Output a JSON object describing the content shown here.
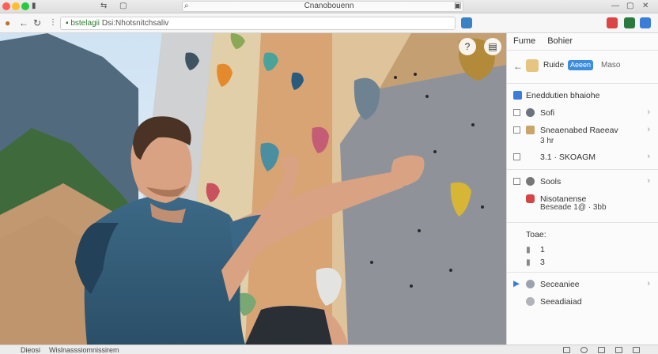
{
  "window": {
    "title": "Cnanobouenn"
  },
  "navbar": {
    "url_host": "bstelagii",
    "url_path": "Dsi:Nhotsnitchsaliv"
  },
  "panel": {
    "tabs": [
      "Fume",
      "Bohier"
    ],
    "top": {
      "label": "Ruide",
      "button": "Aeeen",
      "alt": "Maso"
    },
    "rows": [
      {
        "text": "Eneddutien bhaiohe",
        "icon_color": "#3c7dd9"
      },
      {
        "text": "Sofi",
        "icon_color": "#6b7280"
      },
      {
        "text": "Sneaenabed Raeeav",
        "icon_color": "#c9a56a"
      },
      {
        "text": "3.1 · SKOAGM",
        "icon_color": "#888888"
      },
      {
        "text": "Sools",
        "icon_color": "#777777"
      },
      {
        "text": "Nisotanense",
        "icon_color": "#d64545"
      }
    ],
    "sub_rows": [
      "3 hr",
      "Beseade 1@ · 3bb"
    ],
    "section_title": "Toae:",
    "values": [
      "1",
      "3"
    ],
    "bottom_rows": [
      "Seceaniee",
      "Seeadiaiad"
    ]
  },
  "statusbar": {
    "left": "Dieosi",
    "middle": "Wislnasssiomnissirem"
  }
}
